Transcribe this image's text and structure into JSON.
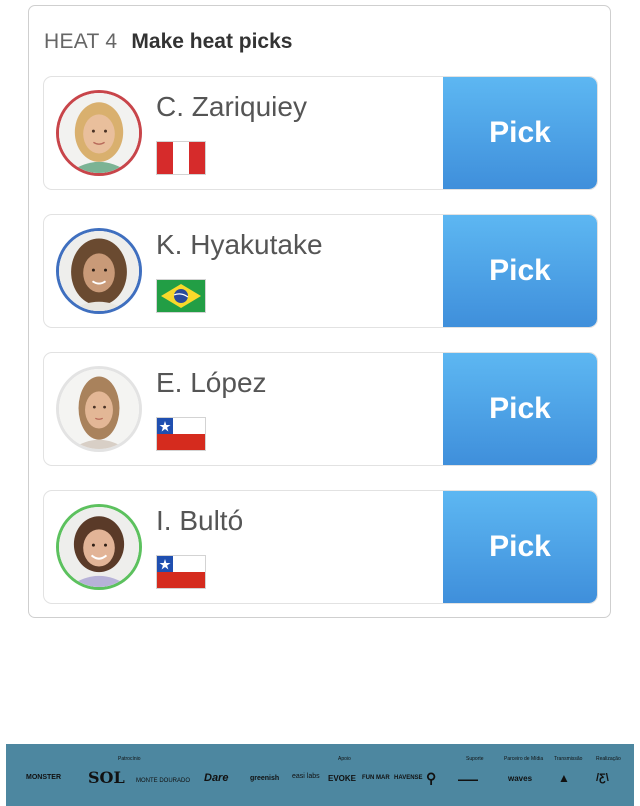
{
  "heat": {
    "label": "HEAT 4",
    "title": "Make heat picks"
  },
  "surfers": [
    {
      "name": "C. Zariquiey",
      "country": "Peru",
      "ring_color": "#c8454a",
      "pick_label": "Pick",
      "flag_icon": "peru-flag-icon"
    },
    {
      "name": "K. Hyakutake",
      "country": "Brazil",
      "ring_color": "#3f6fbf",
      "pick_label": "Pick",
      "flag_icon": "brazil-flag-icon"
    },
    {
      "name": "E. López",
      "country": "Chile",
      "ring_color": "#e0e0e0",
      "pick_label": "Pick",
      "flag_icon": "chile-flag-icon"
    },
    {
      "name": "I. Bultó",
      "country": "Chile",
      "ring_color": "#5cc15e",
      "pick_label": "Pick",
      "flag_icon": "chile-flag-icon"
    }
  ],
  "colors": {
    "pick_button_top": "#5db7f2",
    "pick_button_bottom": "#3f8fdb",
    "sponsor_bar": "#4d87a0"
  },
  "sponsors": {
    "captions": [
      "Patrocínio",
      "Apoio",
      "Suporte",
      "Parceiro de Mídia",
      "Transmissão",
      "Realização"
    ],
    "logos": [
      "MONSTER",
      "SOL",
      "MONTE DOURADO",
      "Dare",
      "greenish",
      "easi labs",
      "EVOKE",
      "FUN MAR",
      "HAVENSE",
      "waves"
    ]
  }
}
